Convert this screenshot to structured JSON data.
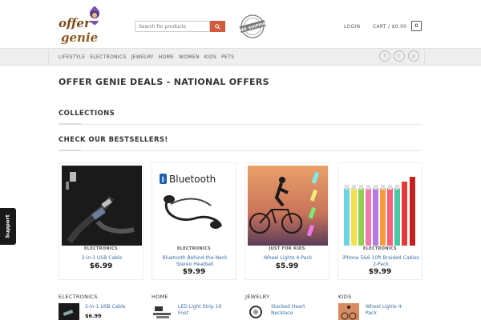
{
  "header": {
    "logo_text": "offer genie",
    "search_placeholder": "Search for products",
    "stamp_text": "FREE SHIPPING",
    "login_label": "LOGIN",
    "cart_label": "CART / $0.00",
    "cart_count": "0"
  },
  "nav": {
    "items": [
      "LIFESTYLE",
      "ELECTRONICS",
      "JEWELRY",
      "HOME",
      "WOMEN",
      "KIDS",
      "PETS"
    ],
    "social": [
      "facebook-icon",
      "twitter-icon",
      "pinterest-icon"
    ]
  },
  "main": {
    "page_title": "OFFER GENIE DEALS - NATIONAL OFFERS",
    "collections_heading": "COLLECTIONS",
    "bestsellers_heading": "CHECK OUR BESTSELLERS!"
  },
  "products": [
    {
      "category": "ELECTRONICS",
      "name": "2-in-1 USB Cable",
      "price": "$6.99"
    },
    {
      "category": "ELECTRONICS",
      "name": "Bluetooth Behind-the-Neck Stereo Headset",
      "price": "$9.99",
      "image_text": "Bluetooth"
    },
    {
      "category": "JUST FOR KIDS",
      "name": "Wheel Lights 4-Pack",
      "price": "$5.99"
    },
    {
      "category": "ELECTRONICS",
      "name": "iPhone 5&6 10ft Braided Cables 2-Pack",
      "price": "$9.99"
    }
  ],
  "footer_lists": [
    {
      "heading": "ELECTRONICS",
      "item": "2-in-1 USB Cable",
      "price": "$6.99"
    },
    {
      "heading": "HOME",
      "item": "LED Light Strip 16 Foot"
    },
    {
      "heading": "JEWELRY",
      "item": "Stacked Heart Necklace"
    },
    {
      "heading": "KIDS",
      "item": "Wheel Lights 4-Pack"
    }
  ],
  "support_tab": "Support",
  "colors": {
    "accent": "#d15b3c",
    "link": "#3a6ea5",
    "nav_bg": "#eeeeee"
  }
}
